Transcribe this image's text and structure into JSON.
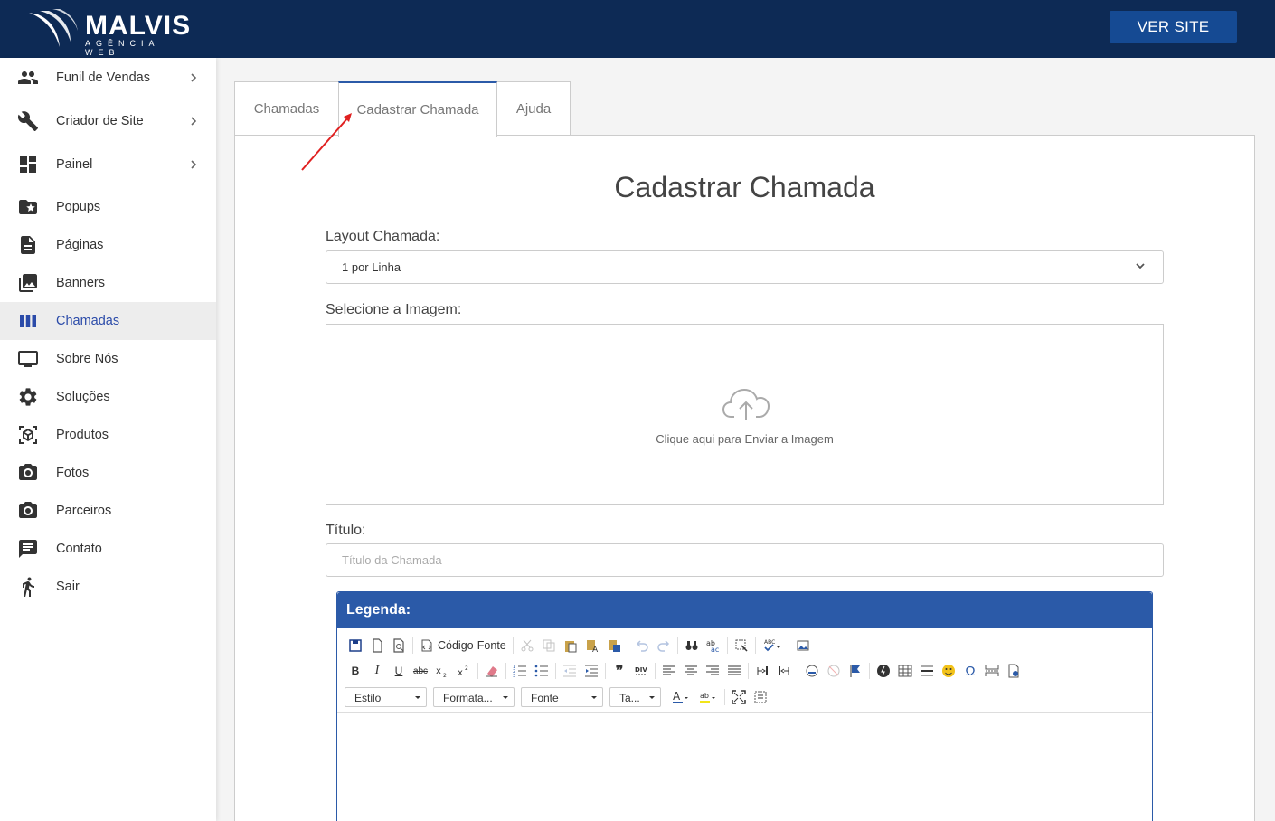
{
  "header": {
    "logo_name": "MALVIS",
    "logo_sub": "AGÊNCIA WEB",
    "ver_site": "VER SITE"
  },
  "sidebar": {
    "items": [
      {
        "label": "Funil de Vendas",
        "icon": "people-icon",
        "has_chevron": true
      },
      {
        "label": "Criador de Site",
        "icon": "wrench-icon",
        "has_chevron": true
      },
      {
        "label": "Painel",
        "icon": "dashboard-icon",
        "has_chevron": true
      },
      {
        "label": "Popups",
        "icon": "folder-star-icon"
      },
      {
        "label": "Páginas",
        "icon": "document-icon"
      },
      {
        "label": "Banners",
        "icon": "photo-library-icon"
      },
      {
        "label": "Chamadas",
        "icon": "columns-icon",
        "active": true
      },
      {
        "label": "Sobre Nós",
        "icon": "monitor-icon"
      },
      {
        "label": "Soluções",
        "icon": "gear-icon"
      },
      {
        "label": "Produtos",
        "icon": "cube-scan-icon"
      },
      {
        "label": "Fotos",
        "icon": "camera-icon"
      },
      {
        "label": "Parceiros",
        "icon": "camera-icon"
      },
      {
        "label": "Contato",
        "icon": "chat-icon"
      },
      {
        "label": "Sair",
        "icon": "walking-person-icon"
      }
    ]
  },
  "tabs": [
    {
      "label": "Chamadas"
    },
    {
      "label": "Cadastrar Chamada",
      "active": true
    },
    {
      "label": "Ajuda"
    }
  ],
  "form": {
    "title": "Cadastrar Chamada",
    "layout_label": "Layout Chamada:",
    "layout_value": "1 por Linha",
    "image_label": "Selecione a Imagem:",
    "upload_text": "Clique aqui para Enviar a Imagem",
    "titulo_label": "Título:",
    "titulo_placeholder": "Título da Chamada"
  },
  "editor": {
    "header": "Legenda:",
    "source_label": "Código-Fonte",
    "combos": [
      "Estilo",
      "Formata...",
      "Fonte",
      "Ta..."
    ]
  },
  "colors": {
    "header_bg": "#0d2a55",
    "accent": "#2b5aa8",
    "active_nav": "#2b4ba9",
    "annotation_arrow": "#e02020"
  }
}
